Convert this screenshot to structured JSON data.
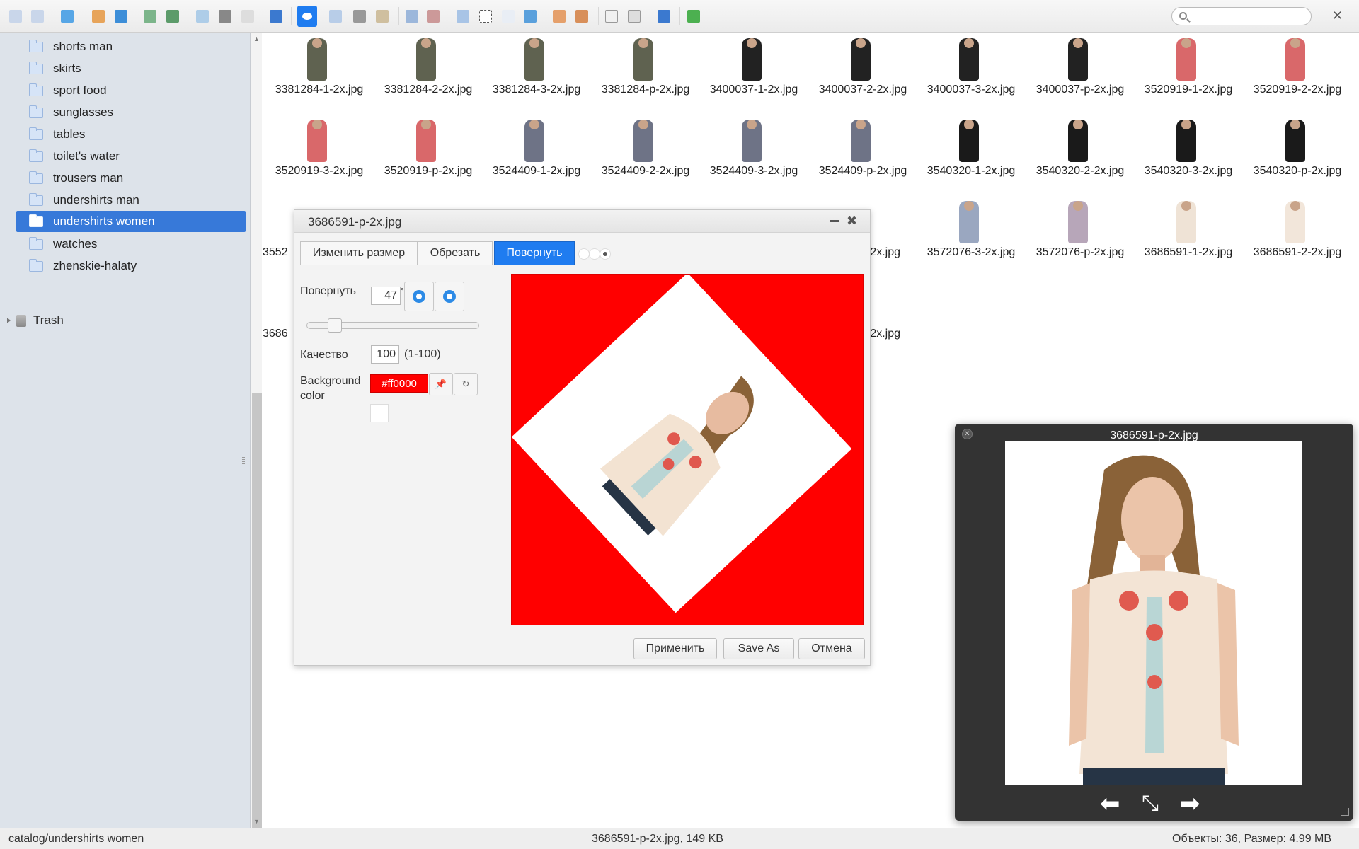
{
  "toolbar": {
    "buttons": [
      "back-icon",
      "forward-icon",
      "reload-icon",
      "home-icon",
      "up-icon",
      "open-icon",
      "save-icon",
      "copy-icon",
      "paste-icon",
      "select-icon",
      "info-icon",
      "view-icon",
      "duplicate-icon",
      "cut-icon",
      "clipboard-icon",
      "archive-icon",
      "extract-icon",
      "rename-icon",
      "select-all-icon",
      "edit-icon",
      "resize-icon",
      "newfolder-icon",
      "upload-icon",
      "window-icon",
      "preview-icon",
      "help-icon",
      "fullscreen-icon"
    ],
    "search_placeholder": "",
    "close_label": "✕"
  },
  "sidebar": {
    "items": [
      {
        "label": "shorts man"
      },
      {
        "label": "skirts"
      },
      {
        "label": "sport food"
      },
      {
        "label": "sunglasses"
      },
      {
        "label": "tables"
      },
      {
        "label": "toilet's water"
      },
      {
        "label": "trousers man"
      },
      {
        "label": "undershirts man"
      },
      {
        "label": "undershirts women",
        "selected": true
      },
      {
        "label": "watches"
      },
      {
        "label": "zhenskie-halaty"
      }
    ],
    "trash_label": "Trash"
  },
  "files": {
    "row1": [
      "3381284-1-2x.jpg",
      "3381284-2-2x.jpg",
      "3381284-3-2x.jpg",
      "3381284-p-2x.jpg",
      "3400037-1-2x.jpg",
      "3400037-2-2x.jpg",
      "3400037-3-2x.jpg",
      "3400037-p-2x.jpg",
      "3520919-1-2x.jpg",
      "3520919-2-2x.jpg"
    ],
    "row2": [
      "3520919-3-2x.jpg",
      "3520919-p-2x.jpg",
      "3524409-1-2x.jpg",
      "3524409-2-2x.jpg",
      "3524409-3-2x.jpg",
      "3524409-p-2x.jpg",
      "3540320-1-2x.jpg",
      "3540320-2-2x.jpg",
      "3540320-3-2x.jpg",
      "3540320-p-2x.jpg"
    ],
    "row3_left": "3552",
    "row3_visible": [
      "-2x.jpg",
      "3572076-3-2x.jpg",
      "3572076-p-2x.jpg",
      "3686591-1-2x.jpg",
      "3686591-2-2x.jpg"
    ],
    "row4_left": "3686",
    "row4_right": "-2x.jpg"
  },
  "editor": {
    "title": "3686591-p-2x.jpg",
    "tabs": [
      "Изменить размер",
      "Обрезать",
      "Повернуть"
    ],
    "rotate_label": "Повернуть",
    "rotate_value": "47",
    "rotate_unit": "°",
    "quality_label": "Качество",
    "quality_value": "100",
    "quality_range": "(1-100)",
    "bg_label_1": "Background",
    "bg_label_2": "color",
    "bg_value": "#ff0000",
    "apply_label": "Применить",
    "saveas_label": "Save As",
    "cancel_label": "Отмена",
    "rotation_degrees": 47,
    "slider_fraction": 0.13
  },
  "quicklook": {
    "title": "3686591-p-2x.jpg"
  },
  "status": {
    "path": "catalog/undershirts women",
    "selection": "3686591-p-2x.jpg, 149 KB",
    "summary": "Объекты: 36, Размер: 4.99 MB"
  },
  "colors": {
    "accent": "#3779d9",
    "tab_active": "#1f7cf0",
    "bg_red": "#ff0000"
  }
}
